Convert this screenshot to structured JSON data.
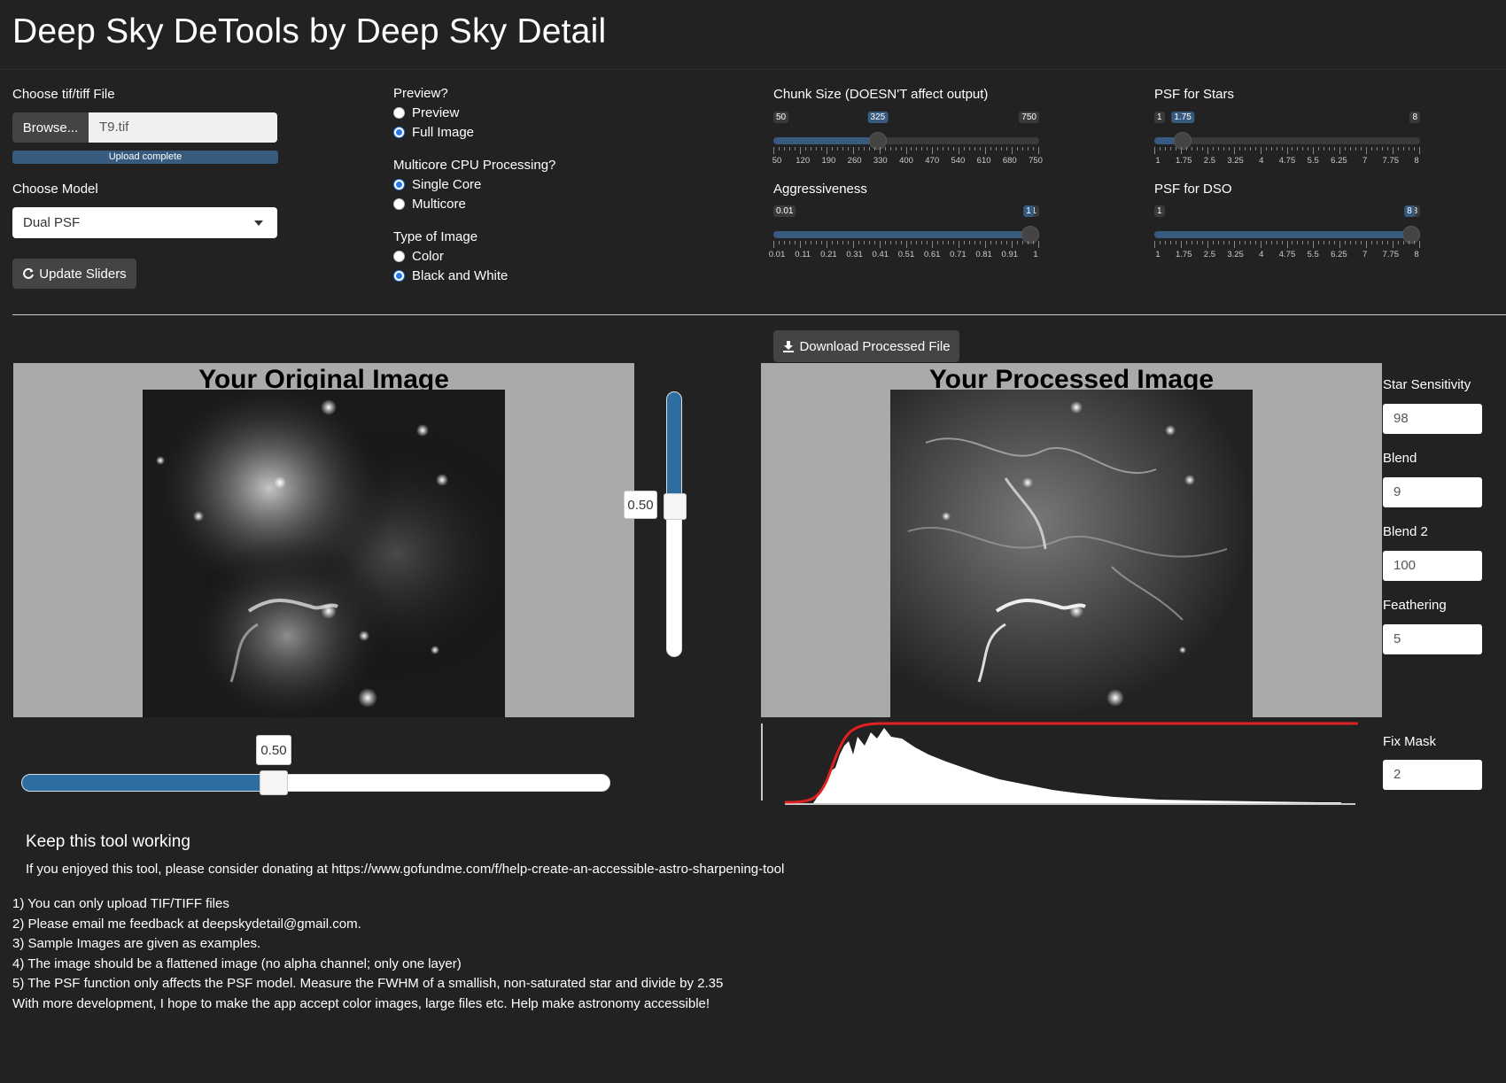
{
  "app": {
    "title": "Deep Sky DeTools by Deep Sky Detail"
  },
  "file": {
    "label": "Choose tif/tiff File",
    "browse_label": "Browse...",
    "file_name": "T9.tif",
    "progress_text": "Upload complete",
    "progress": 1.0
  },
  "model": {
    "label": "Choose Model",
    "selected": "Dual PSF"
  },
  "update_button": {
    "label": "Update Sliders",
    "icon": "refresh-icon"
  },
  "preview": {
    "label": "Preview?",
    "options": [
      {
        "label": "Preview",
        "checked": false
      },
      {
        "label": "Full Image",
        "checked": true
      }
    ]
  },
  "multicore": {
    "label": "Multicore CPU Processing?",
    "options": [
      {
        "label": "Single Core",
        "checked": true
      },
      {
        "label": "Multicore",
        "checked": false
      }
    ]
  },
  "image_type": {
    "label": "Type of Image",
    "options": [
      {
        "label": "Color",
        "checked": false
      },
      {
        "label": "Black and White",
        "checked": true
      }
    ]
  },
  "sliders": {
    "chunk": {
      "label": "Chunk Size (DOESN'T affect output)",
      "min": "50",
      "max": "750",
      "value": "325",
      "fraction": 0.393,
      "ticks": [
        "50",
        "120",
        "190",
        "260",
        "330",
        "400",
        "470",
        "540",
        "610",
        "680",
        "750"
      ]
    },
    "aggr": {
      "label": "Aggressiveness",
      "min": "0.01",
      "max": "1",
      "value": "1",
      "fraction": 1.0,
      "ticks": [
        "0.01",
        "0.11",
        "0.21",
        "0.31",
        "0.41",
        "0.51",
        "0.61",
        "0.71",
        "0.81",
        "0.91",
        "1"
      ]
    },
    "psf_stars": {
      "label": "PSF for Stars",
      "min": "1",
      "max": "8",
      "value": "1.75",
      "fraction": 0.107,
      "ticks": [
        "1",
        "1.75",
        "2.5",
        "3.25",
        "4",
        "4.75",
        "5.5",
        "6.25",
        "7",
        "7.75",
        "8"
      ]
    },
    "psf_dso": {
      "label": "PSF for DSO",
      "min": "1",
      "max": "8",
      "value": "8",
      "fraction": 1.0,
      "ticks": [
        "1",
        "1.75",
        "2.5",
        "3.25",
        "4",
        "4.75",
        "5.5",
        "6.25",
        "7",
        "7.75",
        "8"
      ]
    }
  },
  "download": {
    "label": "Download Processed File",
    "icon": "download-icon"
  },
  "original": {
    "title": "Your Original Image"
  },
  "processed": {
    "title": "Your Processed Image"
  },
  "vertical_slider": {
    "value": "0.50",
    "fraction": 0.5
  },
  "horizontal_slider": {
    "value": "0.50",
    "fraction": 0.5
  },
  "params": {
    "star_sensitivity": {
      "label": "Star Sensitivity",
      "value": "98"
    },
    "blend": {
      "label": "Blend",
      "value": "9"
    },
    "blend2": {
      "label": "Blend 2",
      "value": "100"
    },
    "feathering": {
      "label": "Feathering",
      "value": "5"
    },
    "fix_mask": {
      "label": "Fix Mask",
      "value": "2"
    }
  },
  "footer": {
    "heading": "Keep this tool working",
    "text": "If you enjoyed this tool, please consider donating at https://www.gofundme.com/f/help-create-an-accessible-astro-sharpening-tool",
    "notes": [
      "1) You can only upload TIF/TIFF files",
      "2) Please email me feedback at deepskydetail@gmail.com.",
      "3) Sample Images are given as examples.",
      "4) The image should be a flattened image (no alpha channel; only one layer)",
      "5) The PSF function only affects the PSF model. Measure the FWHM of a smallish, non-saturated star and divide by 2.35",
      "With more development, I hope to make the app accept color images, large files etc. Help make astronomy accessible!"
    ]
  },
  "colors": {
    "background": "#222222",
    "accent": "#375a7f",
    "slider_blue": "#2d6ea2",
    "histogram_curve": "#e02020"
  }
}
